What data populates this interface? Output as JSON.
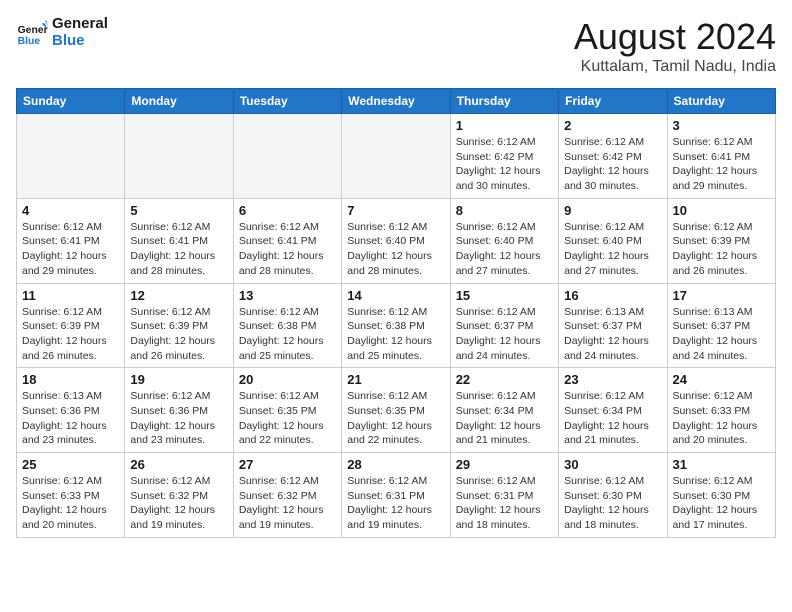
{
  "header": {
    "logo_line1": "General",
    "logo_line2": "Blue",
    "month_year": "August 2024",
    "location": "Kuttalam, Tamil Nadu, India"
  },
  "weekdays": [
    "Sunday",
    "Monday",
    "Tuesday",
    "Wednesday",
    "Thursday",
    "Friday",
    "Saturday"
  ],
  "weeks": [
    [
      {
        "day": "",
        "info": ""
      },
      {
        "day": "",
        "info": ""
      },
      {
        "day": "",
        "info": ""
      },
      {
        "day": "",
        "info": ""
      },
      {
        "day": "1",
        "info": "Sunrise: 6:12 AM\nSunset: 6:42 PM\nDaylight: 12 hours\nand 30 minutes."
      },
      {
        "day": "2",
        "info": "Sunrise: 6:12 AM\nSunset: 6:42 PM\nDaylight: 12 hours\nand 30 minutes."
      },
      {
        "day": "3",
        "info": "Sunrise: 6:12 AM\nSunset: 6:41 PM\nDaylight: 12 hours\nand 29 minutes."
      }
    ],
    [
      {
        "day": "4",
        "info": "Sunrise: 6:12 AM\nSunset: 6:41 PM\nDaylight: 12 hours\nand 29 minutes."
      },
      {
        "day": "5",
        "info": "Sunrise: 6:12 AM\nSunset: 6:41 PM\nDaylight: 12 hours\nand 28 minutes."
      },
      {
        "day": "6",
        "info": "Sunrise: 6:12 AM\nSunset: 6:41 PM\nDaylight: 12 hours\nand 28 minutes."
      },
      {
        "day": "7",
        "info": "Sunrise: 6:12 AM\nSunset: 6:40 PM\nDaylight: 12 hours\nand 28 minutes."
      },
      {
        "day": "8",
        "info": "Sunrise: 6:12 AM\nSunset: 6:40 PM\nDaylight: 12 hours\nand 27 minutes."
      },
      {
        "day": "9",
        "info": "Sunrise: 6:12 AM\nSunset: 6:40 PM\nDaylight: 12 hours\nand 27 minutes."
      },
      {
        "day": "10",
        "info": "Sunrise: 6:12 AM\nSunset: 6:39 PM\nDaylight: 12 hours\nand 26 minutes."
      }
    ],
    [
      {
        "day": "11",
        "info": "Sunrise: 6:12 AM\nSunset: 6:39 PM\nDaylight: 12 hours\nand 26 minutes."
      },
      {
        "day": "12",
        "info": "Sunrise: 6:12 AM\nSunset: 6:39 PM\nDaylight: 12 hours\nand 26 minutes."
      },
      {
        "day": "13",
        "info": "Sunrise: 6:12 AM\nSunset: 6:38 PM\nDaylight: 12 hours\nand 25 minutes."
      },
      {
        "day": "14",
        "info": "Sunrise: 6:12 AM\nSunset: 6:38 PM\nDaylight: 12 hours\nand 25 minutes."
      },
      {
        "day": "15",
        "info": "Sunrise: 6:12 AM\nSunset: 6:37 PM\nDaylight: 12 hours\nand 24 minutes."
      },
      {
        "day": "16",
        "info": "Sunrise: 6:13 AM\nSunset: 6:37 PM\nDaylight: 12 hours\nand 24 minutes."
      },
      {
        "day": "17",
        "info": "Sunrise: 6:13 AM\nSunset: 6:37 PM\nDaylight: 12 hours\nand 24 minutes."
      }
    ],
    [
      {
        "day": "18",
        "info": "Sunrise: 6:13 AM\nSunset: 6:36 PM\nDaylight: 12 hours\nand 23 minutes."
      },
      {
        "day": "19",
        "info": "Sunrise: 6:12 AM\nSunset: 6:36 PM\nDaylight: 12 hours\nand 23 minutes."
      },
      {
        "day": "20",
        "info": "Sunrise: 6:12 AM\nSunset: 6:35 PM\nDaylight: 12 hours\nand 22 minutes."
      },
      {
        "day": "21",
        "info": "Sunrise: 6:12 AM\nSunset: 6:35 PM\nDaylight: 12 hours\nand 22 minutes."
      },
      {
        "day": "22",
        "info": "Sunrise: 6:12 AM\nSunset: 6:34 PM\nDaylight: 12 hours\nand 21 minutes."
      },
      {
        "day": "23",
        "info": "Sunrise: 6:12 AM\nSunset: 6:34 PM\nDaylight: 12 hours\nand 21 minutes."
      },
      {
        "day": "24",
        "info": "Sunrise: 6:12 AM\nSunset: 6:33 PM\nDaylight: 12 hours\nand 20 minutes."
      }
    ],
    [
      {
        "day": "25",
        "info": "Sunrise: 6:12 AM\nSunset: 6:33 PM\nDaylight: 12 hours\nand 20 minutes."
      },
      {
        "day": "26",
        "info": "Sunrise: 6:12 AM\nSunset: 6:32 PM\nDaylight: 12 hours\nand 19 minutes."
      },
      {
        "day": "27",
        "info": "Sunrise: 6:12 AM\nSunset: 6:32 PM\nDaylight: 12 hours\nand 19 minutes."
      },
      {
        "day": "28",
        "info": "Sunrise: 6:12 AM\nSunset: 6:31 PM\nDaylight: 12 hours\nand 19 minutes."
      },
      {
        "day": "29",
        "info": "Sunrise: 6:12 AM\nSunset: 6:31 PM\nDaylight: 12 hours\nand 18 minutes."
      },
      {
        "day": "30",
        "info": "Sunrise: 6:12 AM\nSunset: 6:30 PM\nDaylight: 12 hours\nand 18 minutes."
      },
      {
        "day": "31",
        "info": "Sunrise: 6:12 AM\nSunset: 6:30 PM\nDaylight: 12 hours\nand 17 minutes."
      }
    ]
  ]
}
